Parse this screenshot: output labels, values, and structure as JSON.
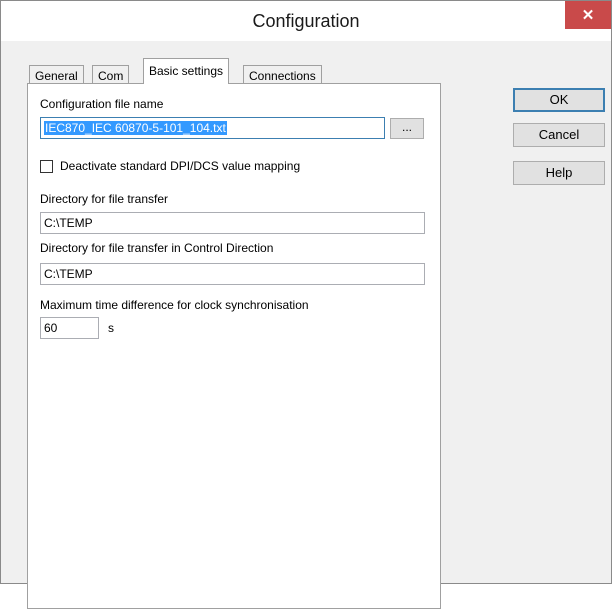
{
  "window": {
    "title": "Configuration",
    "close_glyph": "✕"
  },
  "tabs": [
    {
      "label": "General"
    },
    {
      "label": "Com"
    },
    {
      "label": "Basic settings",
      "active": true
    },
    {
      "label": "Connections"
    }
  ],
  "basic_settings": {
    "config_file_label": "Configuration file name",
    "config_file_value": "IEC870_IEC 60870-5-101_104.txt",
    "browse_label": "...",
    "deactivate_mapping_label": "Deactivate standard DPI/DCS value mapping",
    "deactivate_mapping_checked": false,
    "file_transfer_dir_label": "Directory for file transfer",
    "file_transfer_dir_value": "C:\\TEMP",
    "control_dir_label": "Directory for file transfer in Control Direction",
    "control_dir_value": "C:\\TEMP",
    "max_time_label": "Maximum time difference for clock synchronisation",
    "max_time_value": "60",
    "max_time_unit": "s"
  },
  "buttons": {
    "ok": "OK",
    "cancel": "Cancel",
    "help": "Help"
  },
  "colors": {
    "selection": "#3399ff",
    "close": "#c94a4a"
  }
}
